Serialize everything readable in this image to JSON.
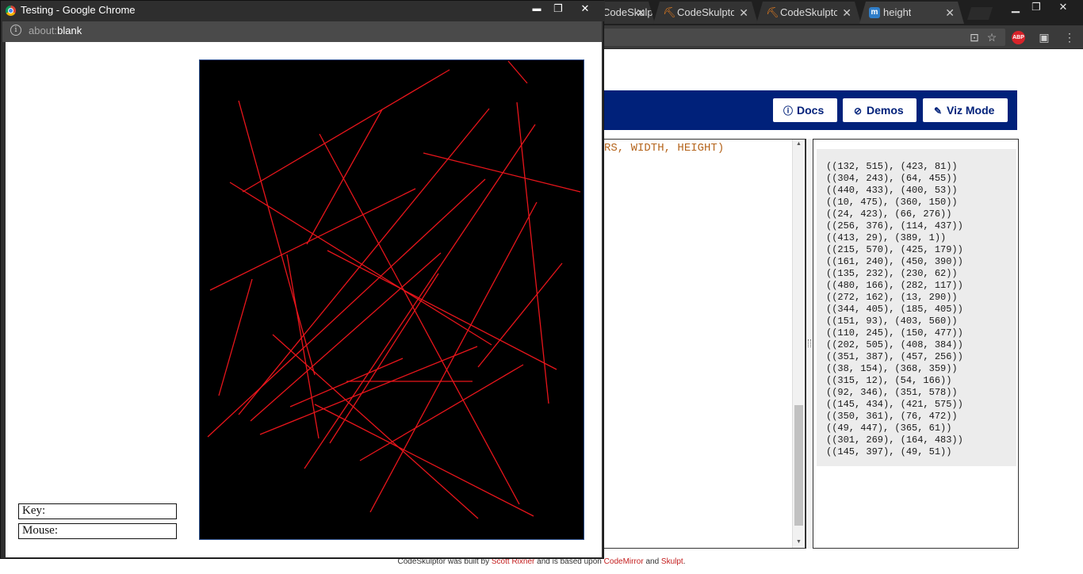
{
  "browser": {
    "tabs": [
      {
        "title": "CodeSkulptor",
        "icon": "hammer-icon"
      },
      {
        "title": "CodeSkulptor",
        "icon": "hammer-icon"
      },
      {
        "title": "CodeSkulptor",
        "icon": "hammer-icon"
      },
      {
        "title": "height",
        "icon": "mdn-icon"
      }
    ]
  },
  "codeskulptor": {
    "buttons": {
      "docs": "Docs",
      "demos": "Demos",
      "viz": "Viz Mode"
    },
    "code_visible": "RS, WIDTH, HEIGHT)",
    "output_lines": [
      "((132, 515), (423, 81))",
      "((304, 243), (64, 455))",
      "((440, 433), (400, 53))",
      "((10, 475), (360, 150))",
      "((24, 423), (66, 276))",
      "((256, 376), (114, 437))",
      "((413, 29), (389, 1))",
      "((215, 570), (425, 179))",
      "((161, 240), (450, 390))",
      "((135, 232), (230, 62))",
      "((480, 166), (282, 117))",
      "((272, 162), (13, 290))",
      "((344, 405), (185, 405))",
      "((151, 93), (403, 560))",
      "((110, 245), (150, 477))",
      "((202, 505), (408, 384))",
      "((351, 387), (457, 256))",
      "((38, 154), (368, 359))",
      "((315, 12), (54, 166))",
      "((92, 346), (351, 578))",
      "((145, 434), (421, 575))",
      "((350, 361), (76, 472))",
      "((49, 447), (365, 61))",
      "((301, 269), (164, 483))",
      "((145, 397), (49, 51))"
    ],
    "footer": {
      "prefix": "CodeSkulptor was built by ",
      "author": "Scott Rixner",
      "middle": " and is based upon ",
      "lib1": "CodeMirror",
      "and": " and ",
      "lib2": "Skulpt",
      "end": "."
    }
  },
  "popup": {
    "window_title": "Testing - Google Chrome",
    "address_scheme": "about:",
    "address_path": "blank",
    "key_label": "Key:",
    "mouse_label": "Mouse:",
    "canvas_background": "#000000",
    "line_color": "#e8151b",
    "segments": [
      [
        [
          132,
          515
        ],
        [
          423,
          81
        ]
      ],
      [
        [
          304,
          243
        ],
        [
          64,
          455
        ]
      ],
      [
        [
          440,
          433
        ],
        [
          400,
          53
        ]
      ],
      [
        [
          10,
          475
        ],
        [
          360,
          150
        ]
      ],
      [
        [
          24,
          423
        ],
        [
          66,
          276
        ]
      ],
      [
        [
          256,
          376
        ],
        [
          114,
          437
        ]
      ],
      [
        [
          413,
          29
        ],
        [
          389,
          1
        ]
      ],
      [
        [
          215,
          570
        ],
        [
          425,
          179
        ]
      ],
      [
        [
          161,
          240
        ],
        [
          450,
          390
        ]
      ],
      [
        [
          135,
          232
        ],
        [
          230,
          62
        ]
      ],
      [
        [
          480,
          166
        ],
        [
          282,
          117
        ]
      ],
      [
        [
          272,
          162
        ],
        [
          13,
          290
        ]
      ],
      [
        [
          344,
          405
        ],
        [
          185,
          405
        ]
      ],
      [
        [
          151,
          93
        ],
        [
          403,
          560
        ]
      ],
      [
        [
          110,
          245
        ],
        [
          150,
          477
        ]
      ],
      [
        [
          202,
          505
        ],
        [
          408,
          384
        ]
      ],
      [
        [
          351,
          387
        ],
        [
          457,
          256
        ]
      ],
      [
        [
          38,
          154
        ],
        [
          368,
          359
        ]
      ],
      [
        [
          315,
          12
        ],
        [
          54,
          166
        ]
      ],
      [
        [
          92,
          346
        ],
        [
          351,
          578
        ]
      ],
      [
        [
          145,
          434
        ],
        [
          421,
          575
        ]
      ],
      [
        [
          350,
          361
        ],
        [
          76,
          472
        ]
      ],
      [
        [
          49,
          447
        ],
        [
          365,
          61
        ]
      ],
      [
        [
          301,
          269
        ],
        [
          164,
          483
        ]
      ],
      [
        [
          145,
          397
        ],
        [
          49,
          51
        ]
      ]
    ]
  }
}
